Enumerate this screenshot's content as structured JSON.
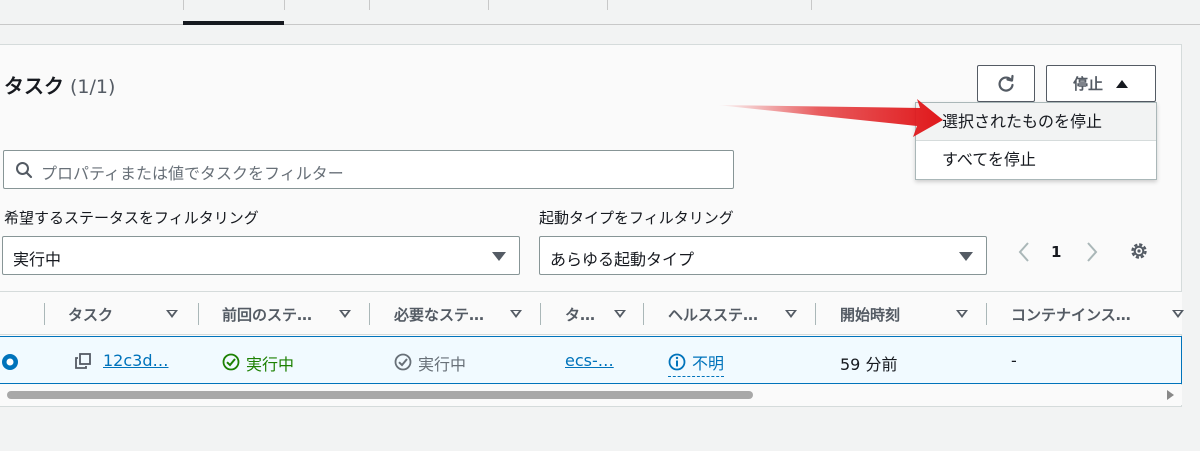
{
  "section": {
    "title": "タスク",
    "count": "(1/1)"
  },
  "actions": {
    "stop_label": "停止"
  },
  "stop_menu": [
    {
      "label": "選択されたものを停止"
    },
    {
      "label": "すべてを停止"
    }
  ],
  "search": {
    "placeholder": "プロパティまたは値でタスクをフィルター"
  },
  "filters": {
    "status": {
      "label": "希望するステータスをフィルタリング",
      "value": "実行中"
    },
    "launch": {
      "label": "起動タイプをフィルタリング",
      "value": "あらゆる起動タイプ"
    }
  },
  "pagination": {
    "current_page": "1"
  },
  "table": {
    "columns": [
      "タスク",
      "前回のステ…",
      "必要なステ…",
      "タ…",
      "ヘルスステ…",
      "開始時刻",
      "コンテナインス…"
    ],
    "row": {
      "task": "12c3d…",
      "last_status": "実行中",
      "desired_status": "実行中",
      "task_definition": "ecs-…",
      "health": "不明",
      "started": "59 分前",
      "container_instance": "-"
    }
  },
  "colors": {
    "accent": "#0073bb",
    "success": "#1d8102",
    "annotation_arrow": "#e0181b"
  }
}
